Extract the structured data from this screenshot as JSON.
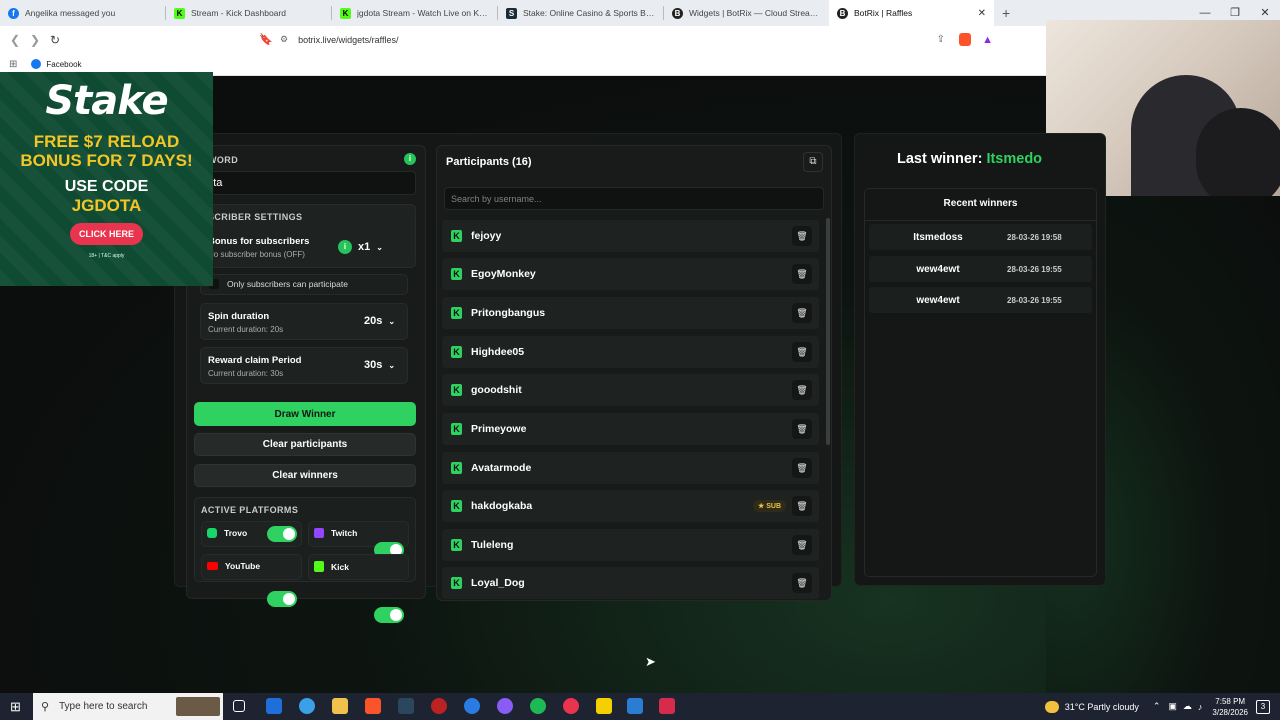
{
  "browser": {
    "tabs": [
      {
        "title": "Angelika messaged you",
        "icon": "facebook-icon",
        "color": "#1877f2",
        "glyph": "f"
      },
      {
        "title": "Stream - Kick Dashboard",
        "icon": "kick-icon",
        "color": "#53fc18",
        "glyph": "K"
      },
      {
        "title": "jgdota Stream - Watch Live on Kick",
        "icon": "kick-icon",
        "color": "#53fc18",
        "glyph": "K"
      },
      {
        "title": "Stake: Online Casino & Sports Betting",
        "icon": "stake-icon",
        "color": "#1a2c38",
        "glyph": "S"
      },
      {
        "title": "Widgets | BotRix — Cloud Streaming",
        "icon": "botrix-icon",
        "color": "#222222",
        "glyph": "B"
      },
      {
        "title": "BotRix | Raffles",
        "icon": "botrix-icon",
        "color": "#222222",
        "glyph": "B"
      }
    ],
    "url": "botrix.live/widgets/raffles/",
    "bookmark": "Facebook"
  },
  "promo": {
    "logo": "Stake",
    "offer_line1": "FREE $7 RELOAD",
    "offer_line2": "BONUS FOR 7 DAYS!",
    "code_line1": "USE CODE",
    "code_line2": "JGDOTA",
    "button": "CLICK HERE",
    "fine_print": "18+ | T&C apply"
  },
  "settings": {
    "keyword_label": "WORD",
    "keyword_value": "dota",
    "subscriber_settings_label": "SCRIBER SETTINGS",
    "bonus_title": "Bonus for subscribers",
    "bonus_sub": "No subscriber bonus (OFF)",
    "bonus_value": "x1",
    "only_subs_label": "Only subscribers can participate",
    "spin_title": "Spin duration",
    "spin_sub": "Current duration: 20s",
    "spin_value": "20s",
    "reward_title": "Reward claim Period",
    "reward_sub": "Current duration: 30s",
    "reward_value": "30s",
    "draw_btn": "Draw Winner",
    "clear_participants_btn": "Clear participants",
    "clear_winners_btn": "Clear winners",
    "platforms_label": "ACTIVE PLATFORMS",
    "platforms": [
      {
        "name": "Trovo",
        "icon": "trovo-icon",
        "color": "#19d66b",
        "on": true
      },
      {
        "name": "Twitch",
        "icon": "twitch-icon",
        "color": "#9146ff",
        "on": true
      },
      {
        "name": "YouTube",
        "icon": "youtube-icon",
        "color": "#ff0000",
        "on": true
      },
      {
        "name": "Kick",
        "icon": "kick-icon",
        "color": "#53fc18",
        "on": true
      }
    ]
  },
  "participants": {
    "title": "Participants (16)",
    "search_placeholder": "Search by username...",
    "sub_badge": "SUB",
    "list": [
      "fejoyy",
      "EgoyMonkey",
      "Pritongbangus",
      "Highdee05",
      "gooodshit",
      "Primeyowe",
      "Avatarmode",
      "hakdogkaba",
      "Tuleleng",
      "Loyal_Dog"
    ]
  },
  "winners": {
    "last_winner_label": "Last winner:",
    "last_winner_name": "Itsmedo",
    "recent_title": "Recent winners",
    "recent": [
      {
        "name": "Itsmedoss",
        "date": "28-03-26 19:58"
      },
      {
        "name": "wew4ewt",
        "date": "28-03-26 19:55"
      },
      {
        "name": "wew4ewt",
        "date": "28-03-26 19:55"
      }
    ]
  },
  "taskbar": {
    "search_placeholder": "Type here to search",
    "weather": "31°C  Partly cloudy",
    "time": "7:58 PM",
    "date": "3/28/2026",
    "notifications": "3"
  },
  "colors": {
    "accent": "#2fd160",
    "page_bg": "#0d0f0e",
    "panel_bg": "#181b1a"
  }
}
